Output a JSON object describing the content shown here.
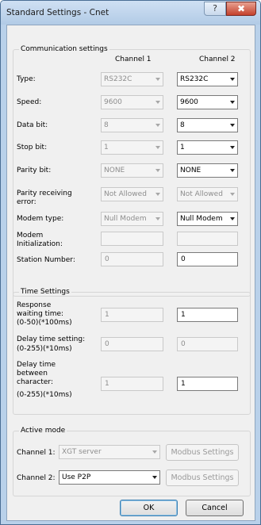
{
  "window": {
    "title": "Standard Settings - Cnet",
    "help_glyph": "?",
    "close_glyph": "✖"
  },
  "communication": {
    "group_label": "Communication settings",
    "channel1_header": "Channel 1",
    "channel2_header": "Channel 2",
    "rows": [
      {
        "label": "Type:",
        "ch1": "RS232C",
        "ch2": "RS232C"
      },
      {
        "label": "Speed:",
        "ch1": "9600",
        "ch2": "9600"
      },
      {
        "label": "Data bit:",
        "ch1": "8",
        "ch2": "8"
      },
      {
        "label": "Stop bit:",
        "ch1": "1",
        "ch2": "1"
      },
      {
        "label": "Parity bit:",
        "ch1": "NONE",
        "ch2": "NONE"
      },
      {
        "label_line1": "Parity receiving",
        "label_line2": "error:",
        "ch1": "Not Allowed",
        "ch2": "Not Allowed"
      },
      {
        "label": "Modem type:",
        "ch1": "Null Modem",
        "ch2": "Null Modem"
      },
      {
        "label_line1": "Modem",
        "label_line2": "Initialization:",
        "ch1": "",
        "ch2": ""
      },
      {
        "label": "Station Number:",
        "ch1": "0",
        "ch2": "0"
      }
    ]
  },
  "time": {
    "group_label": "Time Settings",
    "response": {
      "line1": "Response",
      "line2": "waiting time:",
      "line3": "(0-50)(*100ms)",
      "ch1": "1",
      "ch2": "1"
    },
    "delay": {
      "line1": "Delay time setting:",
      "line2": "(0-255)(*10ms)",
      "ch1": "0",
      "ch2": "0"
    },
    "between": {
      "line1": "Delay time",
      "line2": "between",
      "line3": "character:",
      "line4": "(0-255)(*10ms)",
      "ch1": "1",
      "ch2": "1"
    }
  },
  "active": {
    "group_label": "Active mode",
    "ch1_label": "Channel 1:",
    "ch1_value": "XGT server",
    "ch2_label": "Channel 2:",
    "ch2_value": "Use P2P",
    "modbus_label": "Modbus Settings"
  },
  "buttons": {
    "ok": "OK",
    "cancel": "Cancel"
  }
}
